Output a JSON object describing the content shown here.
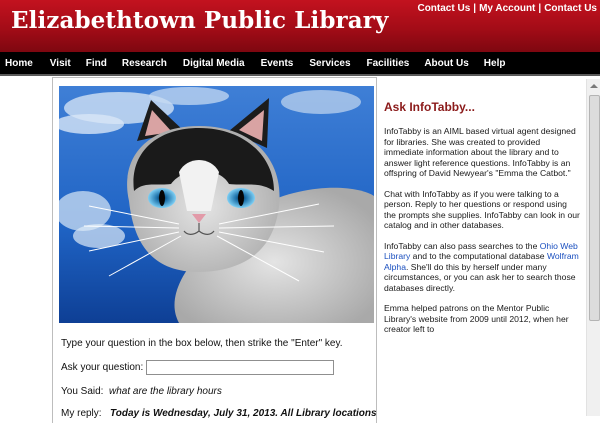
{
  "header": {
    "title": "Elizabethtown Public Library",
    "links": [
      "Contact Us",
      "My Account",
      "Contact Us"
    ],
    "separator": "|"
  },
  "nav": [
    "Home",
    "Visit",
    "Find",
    "Research",
    "Digital Media",
    "Events",
    "Services",
    "Facilities",
    "About Us",
    "Help"
  ],
  "main": {
    "instruction": "Type your question in the box below, then strike the \"Enter\" key.",
    "ask_label": "Ask your question:",
    "ask_value": "",
    "you_said_label": "You Said:",
    "you_said_value": "what are the library hours",
    "reply_label": "My reply:",
    "reply_value": "Today is Wednesday, July 31, 2013. All Library locations"
  },
  "sidebar": {
    "heading": "Ask InfoTabby...",
    "p1": "InfoTabby is an AIML based virtual agent designed for libraries. She was created to provided immediate information about the library and to answer light reference questions. InfoTabby is an offspring of David Newyear's \"Emma the Catbot.\"",
    "p2": "Chat with InfoTabby as if you were talking to a person.  Reply to her questions or respond using the prompts she supplies.  InfoTabby can look in our catalog and in other databases.",
    "p3a": "InfoTabby can also pass searches to the ",
    "link1": "Ohio Web Library",
    "p3b": " and to the computational database ",
    "link2": "Wolfram Alpha",
    "p3c": ".  She'll do this by herself under many circumstances, or you can ask her to search those databases directly.",
    "p4": " Emma helped patrons on the Mentor Public Library's website from 2009 until 2012, when her creator left to"
  },
  "colors": {
    "header_red": "#a30c17",
    "nav_black": "#000000",
    "sidebar_heading": "#8b1a1a",
    "link_blue": "#1a4fbf"
  }
}
